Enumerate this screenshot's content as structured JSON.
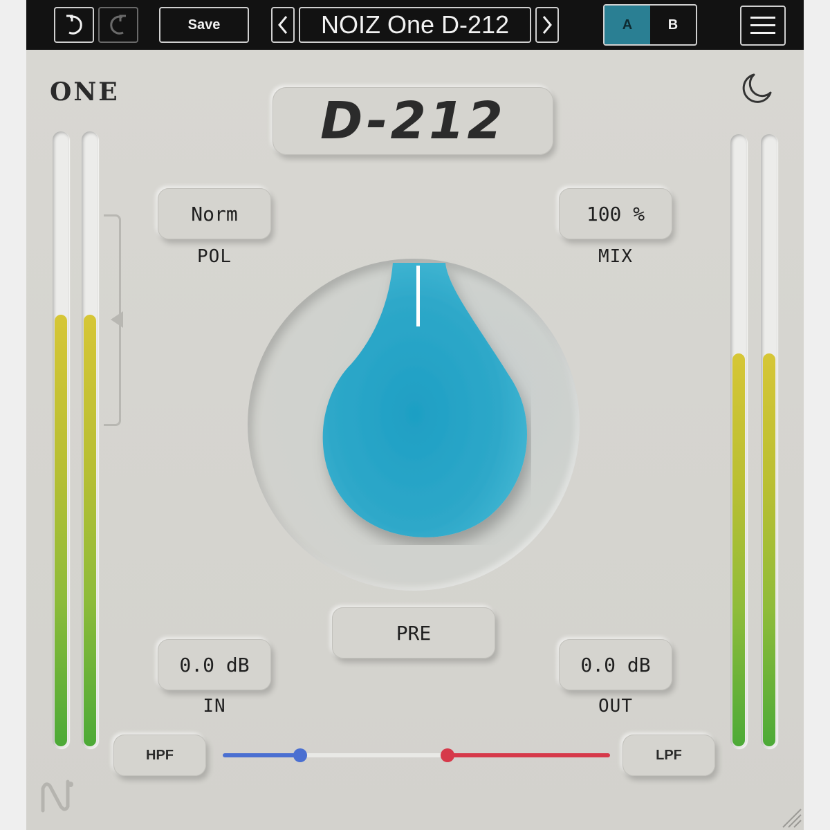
{
  "toolbar": {
    "undo_icon": "undo-icon",
    "redo_icon": "redo-icon",
    "save_label": "Save",
    "prev_icon": "chevron-left-icon",
    "next_icon": "chevron-right-icon",
    "preset_name": "NOIZ One D-212",
    "ab": {
      "a_label": "A",
      "b_label": "B",
      "active": "A"
    },
    "menu_icon": "hamburger-menu-icon"
  },
  "panel": {
    "brand": "ONE",
    "title": "D-212",
    "theme_icon": "moon-icon",
    "pol": {
      "value": "Norm",
      "label": "POL"
    },
    "mix": {
      "value": "100 %",
      "label": "MIX"
    },
    "pre_label": "PRE",
    "in": {
      "value": "0.0 dB",
      "label": "IN"
    },
    "out": {
      "value": "0.0 dB",
      "label": "OUT"
    },
    "hpf_label": "HPF",
    "lpf_label": "LPF",
    "filter": {
      "hpf_position": 0.2,
      "lpf_position": 0.58
    }
  },
  "meters": {
    "input_left_level": 0.7,
    "input_right_level": 0.7,
    "output_left_level": 0.64,
    "output_right_level": 0.64
  },
  "colors": {
    "knob": "#2ea8c9",
    "active_ab": "#2a7f93",
    "hpf": "#4a6fd1",
    "lpf": "#d6394a"
  }
}
